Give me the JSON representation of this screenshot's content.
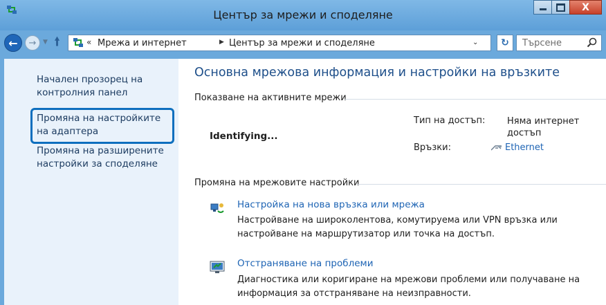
{
  "window": {
    "title": "Център за мрежи и споделяне",
    "close_glyph": "X"
  },
  "navbar": {
    "breadcrumb_prefix": "«",
    "breadcrumb": [
      "Мрежа и интернет",
      "Център за мрежи и споделяне"
    ],
    "search_placeholder": "Търсене"
  },
  "sidebar": {
    "items": [
      {
        "label": "Начален прозорец на контролния панел"
      },
      {
        "label": "Промяна на настройките на адаптера",
        "highlighted": true
      },
      {
        "label": "Промяна на разширените настройки за споделяне"
      }
    ]
  },
  "main": {
    "title": "Основна мрежова информация и настройки на връзките",
    "active_networks": {
      "heading": "Показване на активните мрежи",
      "network_name": "Identifying...",
      "access_type_label": "Тип на достъп:",
      "access_type_value": "Няма интернет достъп",
      "connections_label": "Връзки:",
      "connections_value": "Ethernet"
    },
    "change_settings": {
      "heading": "Промяна на мрежовите настройки",
      "tasks": [
        {
          "icon": "new-connection-icon",
          "title": "Настройка на нова връзка или мрежа",
          "description": "Настройване на широколентова, комутируема или VPN връзка или настройване на маршрутизатор или точка на достъп."
        },
        {
          "icon": "troubleshoot-icon",
          "title": "Отстраняване на проблеми",
          "description": "Диагностика или коригиране на мрежови проблеми или получаване на информация за отстраняване на неизправности."
        }
      ]
    }
  },
  "colors": {
    "titlebar": "#6ba9dc",
    "sidebar_bg": "#e9f2fb",
    "link": "#1e64b4",
    "highlight_border": "#0e6fbe"
  }
}
